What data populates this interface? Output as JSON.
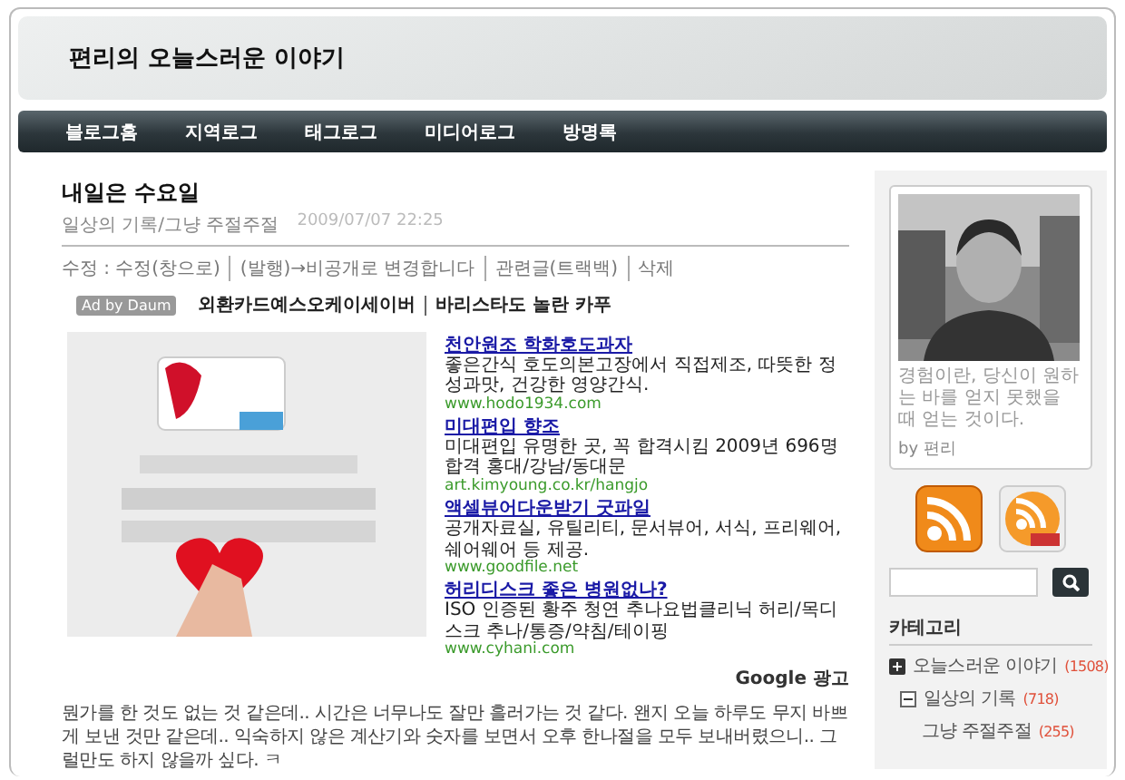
{
  "blog_title": "편리의 오늘스러운 이야기",
  "nav": [
    "블로그홈",
    "지역로그",
    "태그로그",
    "미디어로그",
    "방명록"
  ],
  "post": {
    "title": "내일은 수요일",
    "category": "일상의 기록/그냥 주절주절",
    "date": "2009/07/07 22:25",
    "admin_label": "수정 :",
    "admin_links": [
      "수정(창으로)",
      "(발행)→비공개로 변경합니다",
      "관련글(트랙백)",
      "삭제"
    ],
    "daum_badge": "Ad by Daum",
    "daum_links": [
      "외환카드예스오케이세이버",
      "바리스타도 놀란 카푸"
    ],
    "banner": {
      "kind": "picture"
    },
    "google_ads": [
      {
        "title": "천안원조 학화호도과자",
        "description": "좋은간식 호도의본고장에서 직접제조, 따뜻한 정성과맛, 건강한 영양간식.",
        "url": "www.hodo1934.com"
      },
      {
        "title": "미대편입 향조",
        "description": "미대편입 유명한 곳, 꼭 합격시킴 2009년 696명 합격 홍대/강남/동대문",
        "url": "art.kimyoung.co.kr/hangjo"
      },
      {
        "title": "액셀뷰어다운받기 굿파일",
        "description": "공개자료실, 유틸리티, 문서뷰어, 서식, 프리웨어, 쉐어웨어 등 제공.",
        "url": "www.goodfile.net"
      },
      {
        "title": "허리디스크 좋은 병원없나?",
        "description": "ISO 인증된 황주 청연 추나요법클리닉 허리/목디스크 추나/통증/약침/테이핑",
        "url": "www.cyhani.com"
      }
    ],
    "ads_label": "Google 광고",
    "body": "뭔가를 한 것도 없는 것 같은데.. 시간은 너무나도 잘만 흘러가는 것 같다. 왠지 오늘 하루도 무지 바쁘게 보낸 것만 같은데.. 익숙하지 않은 계산기와 숫자를 보면서 오후 한나절을 모두 보내버렸으니.. 그럴만도 하지 않을까 싶다. ㅋ"
  },
  "profile": {
    "photo": {
      "kind": "picture"
    },
    "quote": "경험이란, 당신이 원하는 바를 얻지 못했을 때 얻는 것이다.",
    "author": "by 편리"
  },
  "category_heading": "카테고리",
  "category_root": {
    "label": "오늘스러운 이야기",
    "count": "(1508)"
  },
  "categories": [
    {
      "label": "일상의 기록",
      "count": "(718)",
      "expanded": true,
      "children": [
        {
          "label": "그냥 주절주절",
          "count": "(255)"
        }
      ]
    }
  ]
}
